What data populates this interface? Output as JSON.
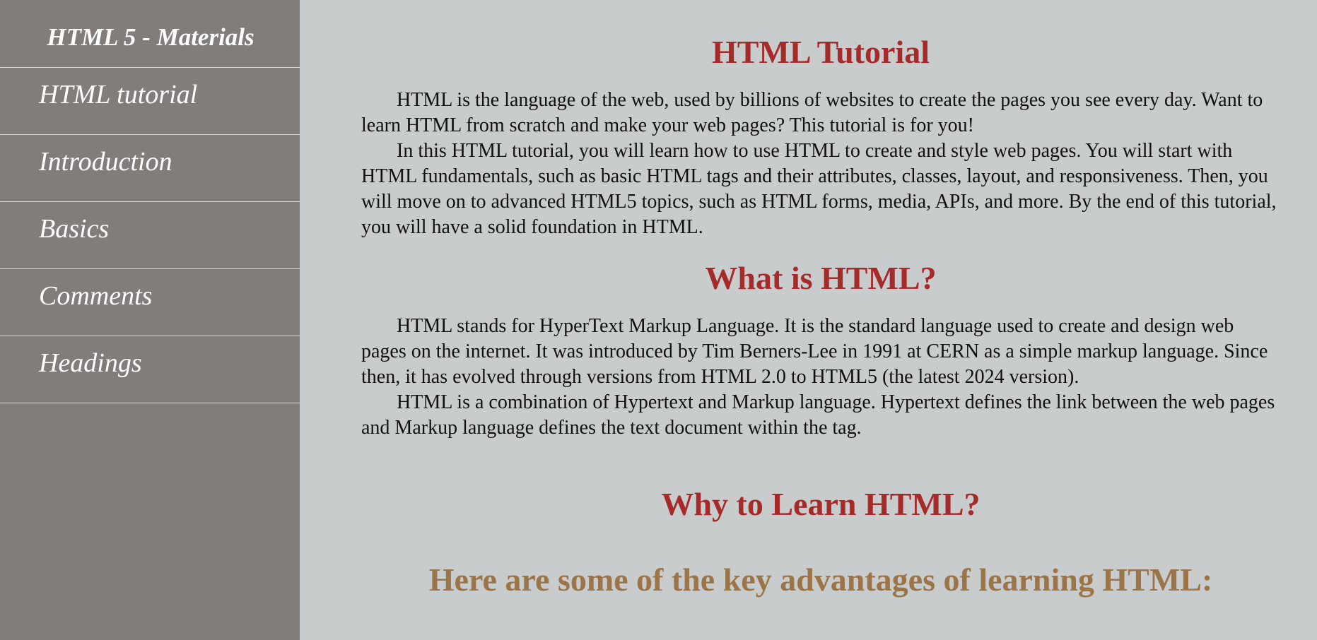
{
  "sidebar": {
    "title": "HTML 5 - Materials",
    "items": [
      {
        "label": "HTML tutorial"
      },
      {
        "label": "Introduction"
      },
      {
        "label": "Basics"
      },
      {
        "label": "Comments"
      },
      {
        "label": "Headings"
      }
    ]
  },
  "main": {
    "heading_tutorial": "HTML Tutorial",
    "para_1": "HTML is the language of the web, used by billions of websites to create the pages you see every day. Want to learn HTML from scratch and make your web pages? This tutorial is for you!",
    "para_2": "In this HTML tutorial, you will learn how to use HTML to create and style web pages. You will start with HTML fundamentals, such as basic HTML tags and their attributes, classes, layout, and responsiveness. Then, you will move on to advanced HTML5 topics, such as HTML forms, media, APIs, and more. By the end of this tutorial, you will have a solid foundation in HTML.",
    "heading_what": "What is HTML?",
    "para_3": "HTML stands for HyperText Markup Language. It is the standard language used to create and design web pages on the internet. It was introduced by Tim Berners-Lee in 1991 at CERN as a simple markup language. Since then, it has evolved through versions from HTML 2.0 to HTML5 (the latest 2024 version).",
    "para_4": "HTML is a combination of Hypertext and Markup language. Hypertext defines the link between the web pages and Markup language defines the text document within the tag.",
    "heading_why": "Why to Learn HTML?",
    "heading_advantages": "Here are some of the key advantages of learning HTML:"
  },
  "colors": {
    "sidebar_bg": "#827d7a",
    "content_bg": "#c9cccd",
    "heading_red": "#a52a2a",
    "heading_brown": "#9b7448"
  }
}
